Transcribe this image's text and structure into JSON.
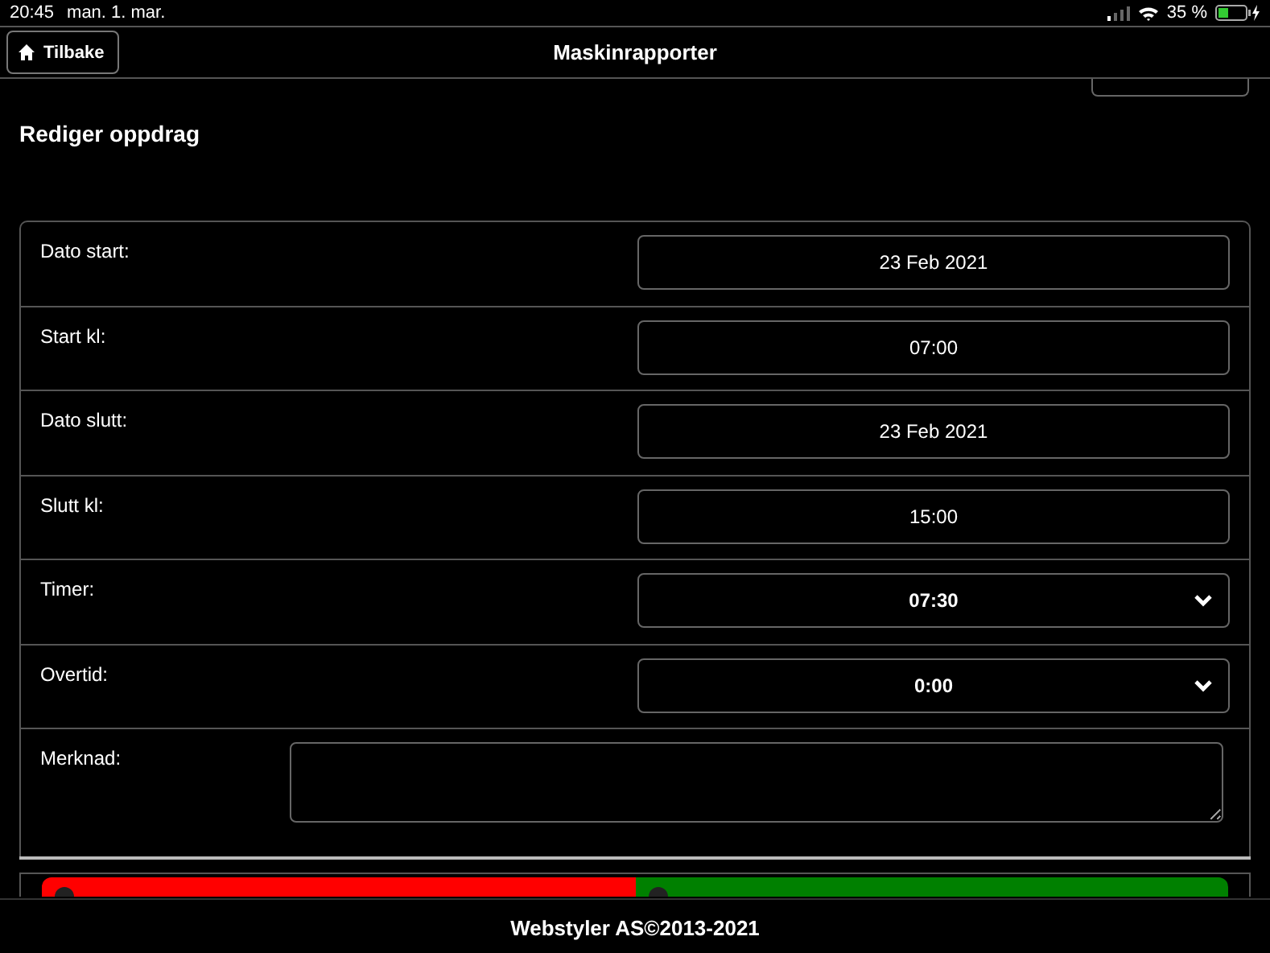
{
  "status_bar": {
    "time": "20:45",
    "date": "man. 1. mar.",
    "battery": "35 %"
  },
  "header": {
    "back_button": "Tilbake",
    "title": "Maskinrapporter"
  },
  "page_title": "Rediger oppdrag",
  "fields": [
    {
      "kind": "input",
      "label": "Dato start:",
      "value": "23 Feb 2021"
    },
    {
      "kind": "input",
      "label": "Start kl:",
      "value": "07:00"
    },
    {
      "kind": "input",
      "label": "Dato slutt:",
      "value": "23 Feb 2021"
    },
    {
      "kind": "input",
      "label": "Slutt kl:",
      "value": "15:00"
    },
    {
      "kind": "select",
      "label": "Timer:",
      "value": "07:30"
    },
    {
      "kind": "select",
      "label": "Overtid:",
      "value": "0:00"
    },
    {
      "kind": "textarea",
      "label": "Merknad:"
    }
  ],
  "action_buttons": [
    {
      "color": "#ff0000"
    },
    {
      "color": "#008000"
    }
  ],
  "footer": "Webstyler AS©2013-2021"
}
